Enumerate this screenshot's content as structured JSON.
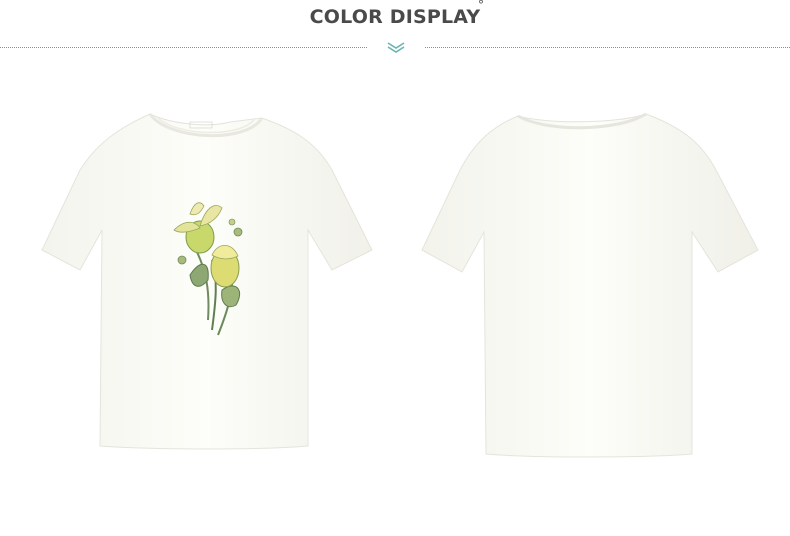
{
  "header": {
    "title": "COLOR DISPLAY",
    "degree_mark": "°",
    "divider_icon": "double-chevron-down-icon",
    "divider_color": "#6bb5b0",
    "rule_color": "#8c8c8c"
  },
  "products": {
    "shirt_color": "#fbfbf6",
    "views": [
      {
        "view": "front",
        "print": "yellow-flower-illustration"
      },
      {
        "view": "back",
        "print": "none"
      }
    ]
  }
}
